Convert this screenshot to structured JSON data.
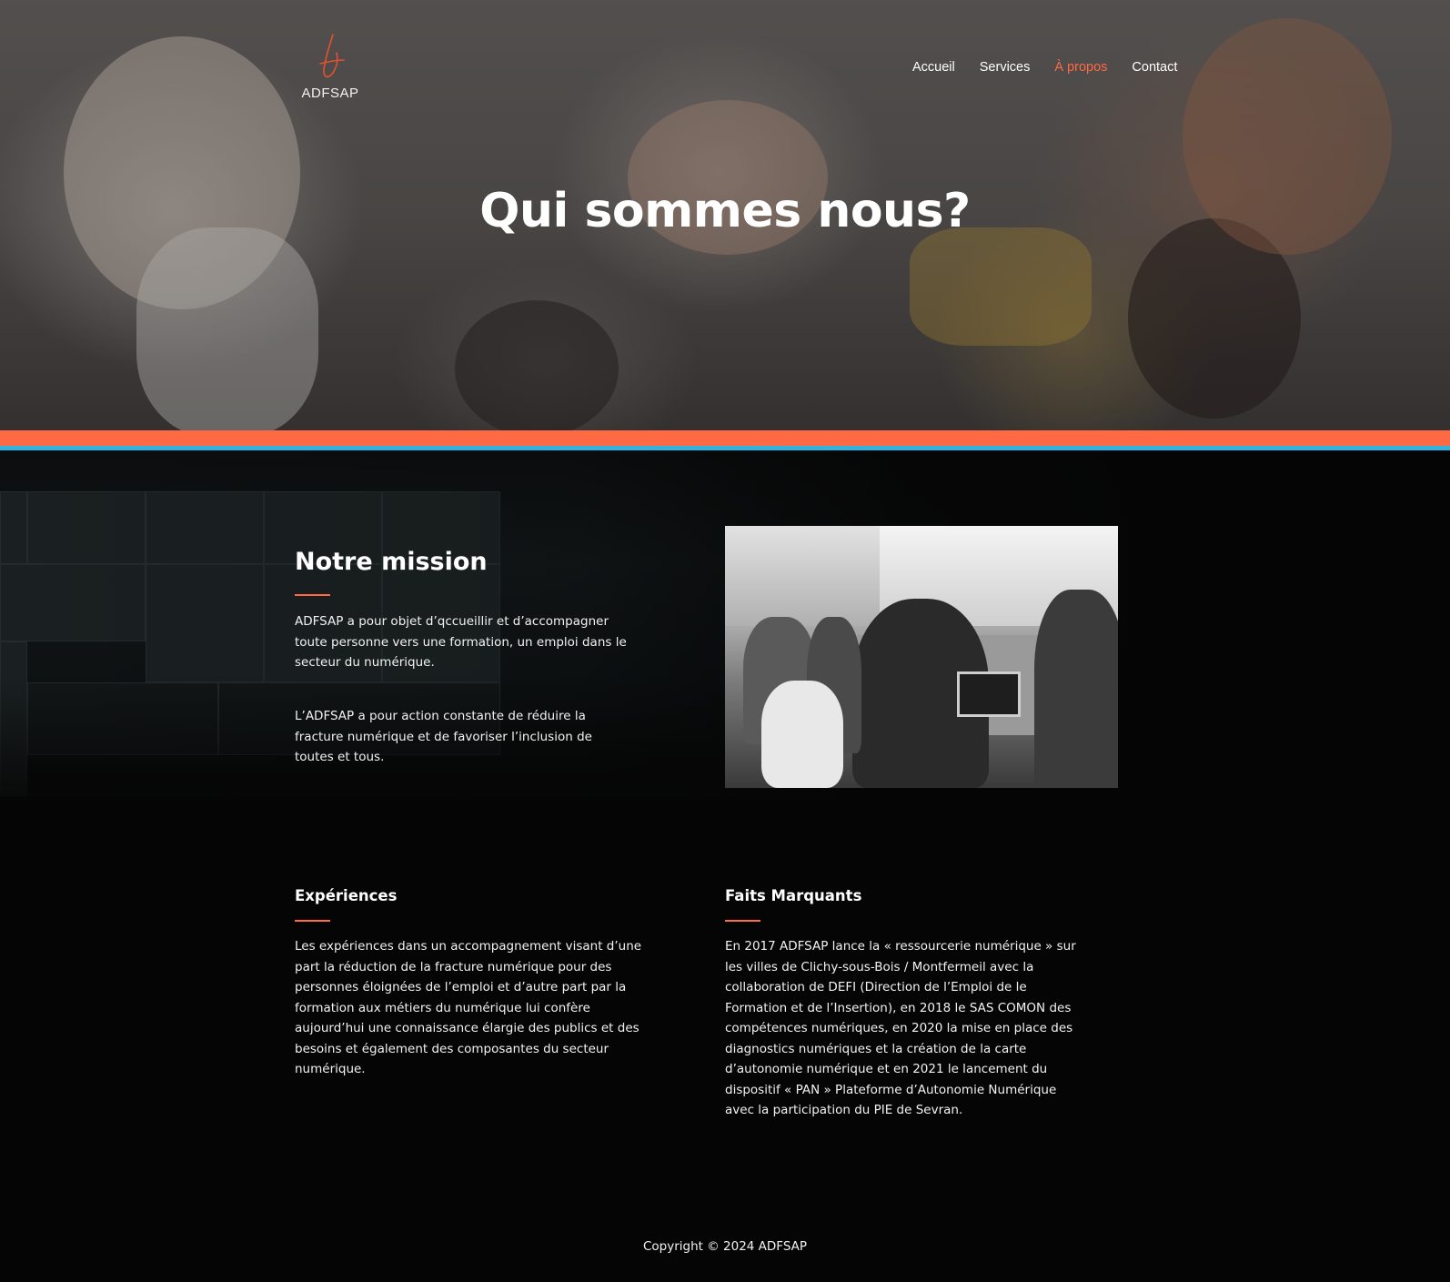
{
  "header": {
    "logo_text": "ADFSAP",
    "nav": [
      {
        "label": "Accueil",
        "active": false
      },
      {
        "label": "Services",
        "active": false
      },
      {
        "label": "À propos",
        "active": true
      },
      {
        "label": "Contact",
        "active": false
      }
    ]
  },
  "hero": {
    "title": "Qui sommes nous?"
  },
  "mission": {
    "title": "Notre mission",
    "paragraph1": "ADFSAP a pour objet d’qccueillir et d’accompagner toute personne vers une formation, un emploi dans le secteur du numérique.",
    "paragraph2": "L’ADFSAP a pour action constante de réduire la fracture numérique et de favoriser l’inclusion de toutes et tous."
  },
  "experiences": {
    "title": "Expériences",
    "text": "Les expériences dans un accompagnement visant d’une part la réduction de la fracture numérique pour des personnes éloignées de l’emploi et d’autre part par la formation aux métiers du numérique lui confère aujourd’hui une connaissance élargie des publics et des besoins et également des composantes du secteur numérique."
  },
  "highlights": {
    "title": "Faits Marquants",
    "text": "En 2017 ADFSAP lance la « ressourcerie numérique » sur les villes de Clichy-sous-Bois / Montfermeil avec la collaboration de DEFI (Direction de l’Emploi de le Formation et de l’Insertion), en 2018 le SAS COMON des compétences numériques, en 2020 la mise en place des diagnostics numériques et la création de la carte d’autonomie numérique et en 2021 le lancement du dispositif « PAN » Plateforme d’Autonomie Numérique avec la participation du PIE de Sevran."
  },
  "footer": {
    "copyright": "Copyright © 2024 ADFSAP"
  },
  "colors": {
    "accent": "#ff6a45",
    "stripe_blue": "#2fb3e0",
    "background": "#050505"
  }
}
